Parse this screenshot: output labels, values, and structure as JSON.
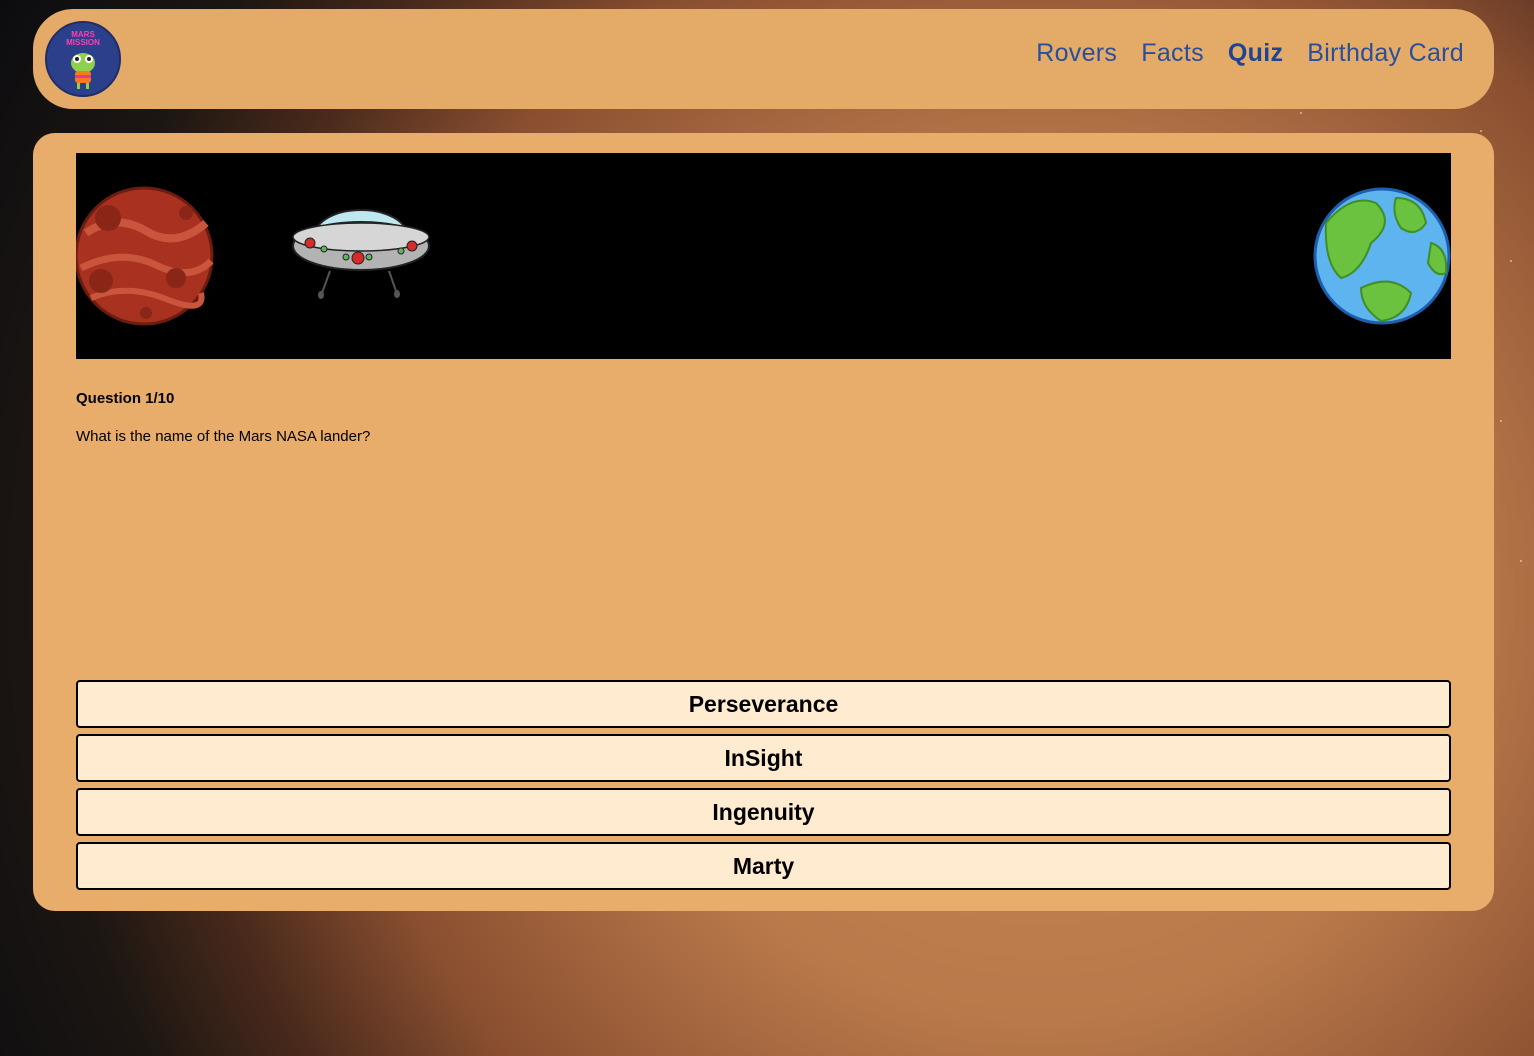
{
  "nav": {
    "logo_alt": "Mars Mission logo",
    "logo_text": "MARS MISSION",
    "links": [
      {
        "label": "Rovers",
        "active": false
      },
      {
        "label": "Facts",
        "active": false
      },
      {
        "label": "Quiz",
        "active": true
      },
      {
        "label": "Birthday Card",
        "active": false
      }
    ]
  },
  "quiz": {
    "counter": "Question 1/10",
    "question": "What is the name of the Mars NASA lander?",
    "answers": [
      "Perseverance",
      "InSight",
      "Ingenuity",
      "Marty"
    ]
  },
  "colors": {
    "nav_bg": "#e4aa68",
    "card_bg": "#e8ad6b",
    "link": "#2a4f9a",
    "answer_bg": "#ffebcf",
    "banner_bg": "#000000"
  },
  "icons": [
    "mars-planet-icon",
    "ufo-icon",
    "earth-planet-icon",
    "alien-mascot-icon"
  ]
}
